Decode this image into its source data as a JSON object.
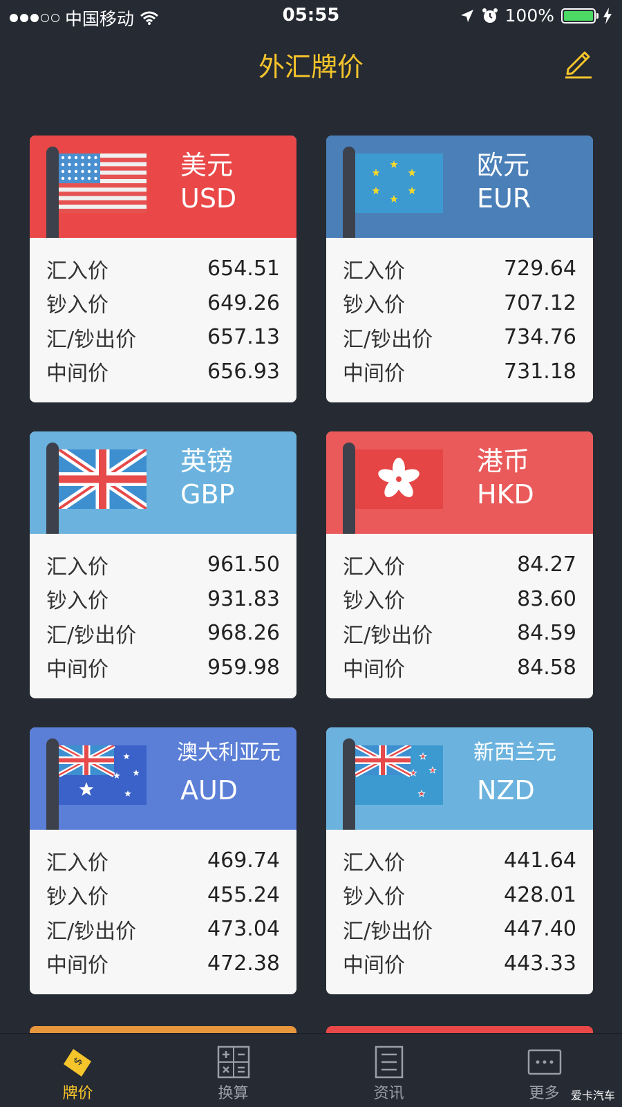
{
  "status_bar": {
    "carrier": "中国移动",
    "time": "05:55",
    "battery": "100%",
    "battery_level": 1.0,
    "signal_bars": 3,
    "battery_color": "#4cd964"
  },
  "header": {
    "title": "外汇牌价",
    "title_color": "#f5c52b"
  },
  "row_labels": [
    "汇入价",
    "钞入价",
    "汇/钞出价",
    "中间价"
  ],
  "currencies": [
    {
      "name": "美元",
      "code": "USD",
      "color": "#ea4848",
      "flag": "us-flag-icon",
      "values": [
        "654.51",
        "649.26",
        "657.13",
        "656.93"
      ]
    },
    {
      "name": "欧元",
      "code": "EUR",
      "color": "#4a7fb8",
      "flag": "eu-flag-icon",
      "values": [
        "729.64",
        "707.12",
        "734.76",
        "731.18"
      ]
    },
    {
      "name": "英镑",
      "code": "GBP",
      "color": "#6bb3de",
      "flag": "uk-flag-icon",
      "values": [
        "961.50",
        "931.83",
        "968.26",
        "959.98"
      ]
    },
    {
      "name": "港币",
      "code": "HKD",
      "color": "#ea5a5a",
      "flag": "hk-flag-icon",
      "values": [
        "84.27",
        "83.60",
        "84.59",
        "84.58"
      ]
    },
    {
      "name": "澳大利亚元",
      "code": "AUD",
      "color": "#5b7fd6",
      "flag": "au-flag-icon",
      "values": [
        "469.74",
        "455.24",
        "473.04",
        "472.38"
      ]
    },
    {
      "name": "新西兰元",
      "code": "NZD",
      "color": "#6bb3de",
      "flag": "nz-flag-icon",
      "values": [
        "441.64",
        "428.01",
        "447.40",
        "443.33"
      ]
    }
  ],
  "partial_cards": [
    {
      "color": "#e8963c"
    },
    {
      "color": "#ea4848"
    }
  ],
  "tabs": [
    {
      "label": "牌价",
      "icon": "price-tag-icon",
      "active": true
    },
    {
      "label": "换算",
      "icon": "calculator-icon",
      "active": false
    },
    {
      "label": "资讯",
      "icon": "news-icon",
      "active": false
    },
    {
      "label": "更多",
      "icon": "more-icon",
      "active": false
    }
  ],
  "watermark": "爱卡汽车"
}
